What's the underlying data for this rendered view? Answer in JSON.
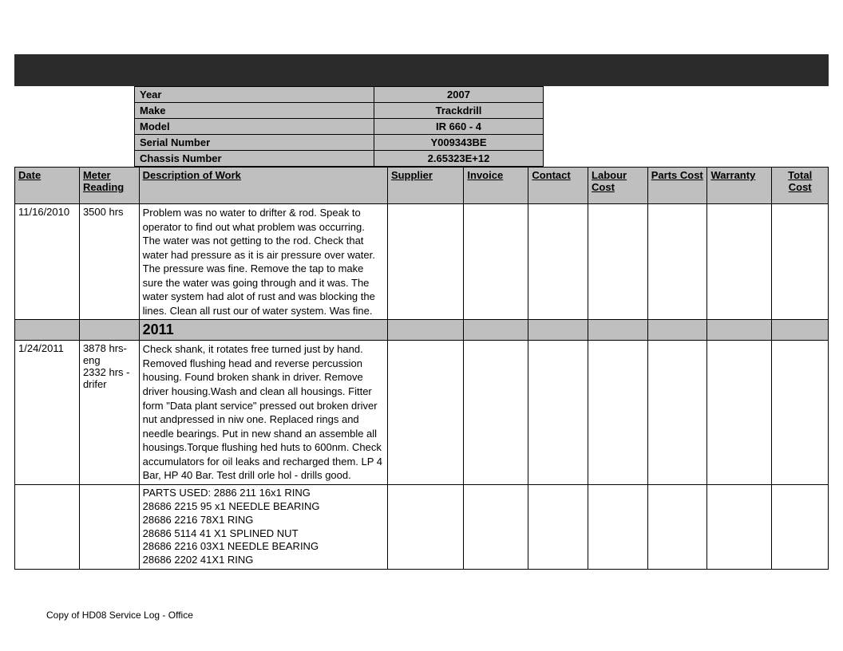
{
  "vehicle": {
    "year_label": "Year",
    "year_value": "2007",
    "make_label": "Make",
    "make_value": "Trackdrill",
    "model_label": "Model",
    "model_value": "IR 660 - 4",
    "serial_label": "Serial Number",
    "serial_value": "Y009343BE",
    "chassis_label": "Chassis Number",
    "chassis_value": "2.65323E+12"
  },
  "columns": {
    "date": "Date",
    "meter": "Meter Reading",
    "desc": "Description of Work",
    "supplier": "Supplier",
    "invoice": "Invoice",
    "contact": "Contact",
    "labour": "Labour Cost",
    "parts": "Parts Cost",
    "warranty": "Warranty",
    "total": "Total Cost"
  },
  "rows": {
    "r1": {
      "date": "11/16/2010",
      "meter": "3500 hrs",
      "desc": "Problem was no water to drifter & rod. Speak to operator to find out what problem was occurring. The water was not getting to the rod. Check that water had pressure as it is air pressure over water. The pressure was fine. Remove the tap to make sure the water was going through and it was. The water system had alot of rust and was blocking the lines. Clean all rust our  of water system. Was fine.",
      "supplier": "",
      "invoice": "",
      "contact": "",
      "labour": "",
      "parts": "",
      "warranty": "",
      "total": ""
    },
    "year_divider": "2011",
    "r2": {
      "date": "1/24/2011",
      "meter": "3878 hrs- eng\n2332 hrs - drifer",
      "desc": "Check shank, it rotates free turned just by hand. Removed flushing head and reverse percussion housing. Found broken shank in driver. Remove driver housing.Wash and clean all housings. Fitter form \"Data plant service\" pressed out broken driver nut andpressed in niw one. Replaced rings and needle bearings. Put in new shand an assemble all housings.Torque flushing hed huts to 600nm. Check accumulators for oil leaks and recharged them. LP 4 Bar, HP 40 Bar. Test drill orle hol - drills good.",
      "supplier": "",
      "invoice": "",
      "contact": "",
      "labour": "",
      "parts": "",
      "warranty": "",
      "total": ""
    },
    "r3": {
      "desc": "PARTS USED: 2886 211 16x1 RING\n28686 2215 95 x1 NEEDLE BEARING\n28686 2216 78X1 RING\n28686 5114 41 X1 SPLINED NUT\n28686 2216 03X1 NEEDLE BEARING\n28686 2202 41X1 RING"
    }
  },
  "footer": "Copy of HD08 Service Log - Office"
}
